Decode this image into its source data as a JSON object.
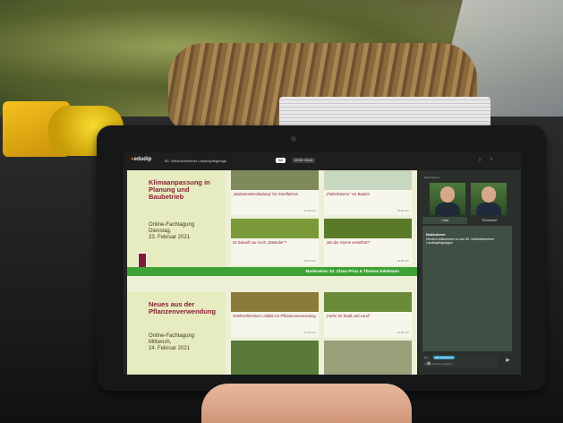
{
  "app": {
    "brand": "edudip",
    "event_title": "83. Veitshöchheimer Landespflegetage",
    "live_label": "live",
    "timer": "00:00 / 00:41"
  },
  "slide": {
    "block1": {
      "title": "Klimaanpassung in Planung und Baubetrieb",
      "subtitle_1": "Online-Fachtagung",
      "subtitle_2": "Dienstag,",
      "subtitle_3": "23. Februar 2021"
    },
    "block2": {
      "title": "Neues aus der Pflanzenverwendung",
      "subtitle_1": "Online-Fachtagung",
      "subtitle_2": "Mittwoch,",
      "subtitle_3": "24. Februar 2021"
    },
    "tiles_row1": [
      {
        "title": "„Wassertankentladung\" für Grünflächen",
        "time": "14:30 Uhr",
        "color": "#7f8a5a"
      },
      {
        "title": "„Flatterbäume\" vor Bauten",
        "time": "15:00 Uhr",
        "color": "#c8d8c0"
      },
      {
        "title": "Ist Zukunft nur noch „Düsteder\"?",
        "time": "15:15 Uhr",
        "color": "#7a9a3a"
      },
      {
        "title": "„Wo der Sonne verwöhnt?\"",
        "time": "15:35 Uhr",
        "color": "#5a7a2a"
      }
    ],
    "tiles_row2": [
      {
        "title": "Veitshöchheimer Leitbild zur Pflanzenverwendung",
        "time": "14:00 Uhr",
        "color": "#8a7a3a"
      },
      {
        "title": "„Farbe für Stadt und Land\"",
        "time": "14:30 Uhr",
        "color": "#6a8a3a"
      },
      {
        "title": "",
        "time": "",
        "color": "#5a7a3a"
      },
      {
        "title": "",
        "time": "",
        "color": "#9aa07a"
      }
    ],
    "moderation": "Moderation: Dr. Claus Prinz & Thomas Edelmann"
  },
  "sidebar": {
    "speakers_label": "Moderatoren",
    "tab_chat": "Chat",
    "tab_participants": "Teilnehmer",
    "chat_heading": "Moderatoren:",
    "chat_text": "Herzlich willkommen zu den 83. Veitshöchheimer Landespflegetagen",
    "chat_to": "An:",
    "chat_recipient": "Alle Teilnehmer",
    "chat_placeholder": "Chatnachricht eingeben"
  },
  "colors": {
    "accent_green": "#3da236",
    "title_maroon": "#8a1f35",
    "slide_bg": "#edf0d6"
  },
  "icons": {
    "send": "send-icon",
    "tools": "tools-icon",
    "grid": "grid-icon",
    "arrow": "arrow-icon"
  }
}
